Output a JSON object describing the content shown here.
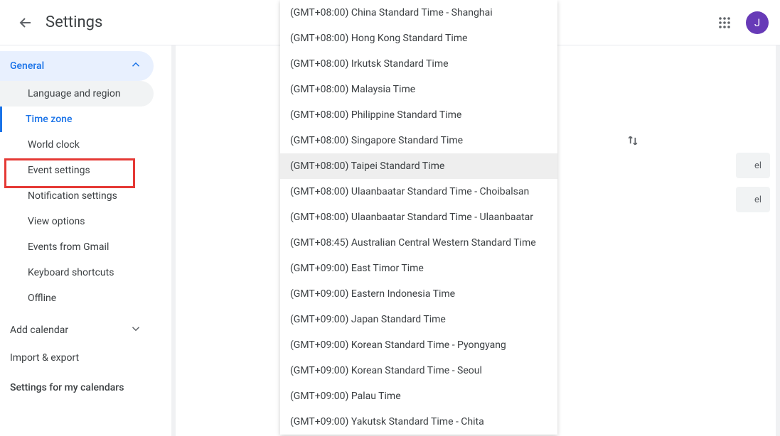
{
  "header": {
    "title": "Settings",
    "avatar_letter": "J"
  },
  "sidebar": {
    "group_label": "General",
    "items": [
      "Language and region",
      "Time zone",
      "World clock",
      "Event settings",
      "Notification settings",
      "View options",
      "Events from Gmail",
      "Keyboard shortcuts",
      "Offline"
    ],
    "active_index": 1,
    "hover_index": 0,
    "add_calendar": "Add calendar",
    "import_export": "Import & export",
    "section_label": "Settings for my calendars"
  },
  "main": {
    "label_peek": "el",
    "label_peek2": "el"
  },
  "dropdown": {
    "options": [
      "(GMT+08:00) China Standard Time - Shanghai",
      "(GMT+08:00) Hong Kong Standard Time",
      "(GMT+08:00) Irkutsk Standard Time",
      "(GMT+08:00) Malaysia Time",
      "(GMT+08:00) Philippine Standard Time",
      "(GMT+08:00) Singapore Standard Time",
      "(GMT+08:00) Taipei Standard Time",
      "(GMT+08:00) Ulaanbaatar Standard Time - Choibalsan",
      "(GMT+08:00) Ulaanbaatar Standard Time - Ulaanbaatar",
      "(GMT+08:45) Australian Central Western Standard Time",
      "(GMT+09:00) East Timor Time",
      "(GMT+09:00) Eastern Indonesia Time",
      "(GMT+09:00) Japan Standard Time",
      "(GMT+09:00) Korean Standard Time - Pyongyang",
      "(GMT+09:00) Korean Standard Time - Seoul",
      "(GMT+09:00) Palau Time",
      "(GMT+09:00) Yakutsk Standard Time - Chita"
    ],
    "highlighted_index": 6
  }
}
